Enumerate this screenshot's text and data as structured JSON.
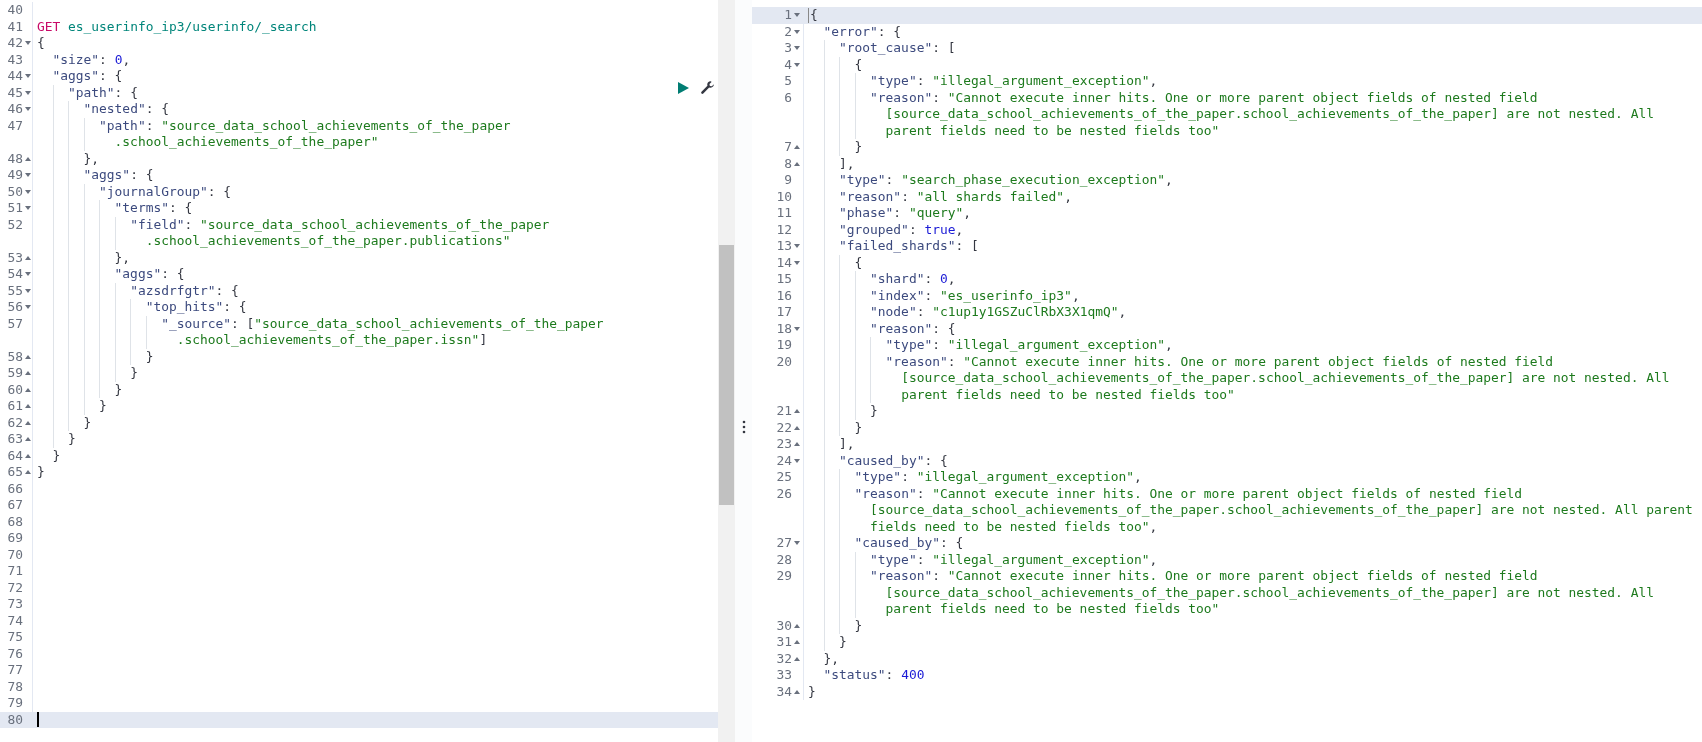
{
  "request_editor": {
    "lines": [
      {
        "number": "40",
        "fold_start": false,
        "fold_end": false,
        "active": false
      },
      {
        "number": "41",
        "fold_start": false,
        "fold_end": false,
        "active": false,
        "tokens": [
          {
            "kind": "method",
            "text": "GET"
          },
          {
            "kind": "url",
            "text": " es_userinfo_ip3/userinfo/_search"
          }
        ]
      },
      {
        "number": "42",
        "fold_start": true,
        "fold_end": false,
        "active": false,
        "tokens": [
          {
            "kind": "punct",
            "text": "{"
          }
        ]
      },
      {
        "number": "43",
        "fold_start": false,
        "fold_end": false,
        "active": false,
        "tokens": [
          {
            "kind": "key",
            "text": "  \"size\""
          },
          {
            "kind": "punct",
            "text": ": "
          },
          {
            "kind": "number",
            "text": "0"
          },
          {
            "kind": "punct",
            "text": ","
          }
        ]
      },
      {
        "number": "44",
        "fold_start": true,
        "fold_end": false,
        "active": false,
        "tokens": [
          {
            "kind": "key",
            "text": "  \"aggs\""
          },
          {
            "kind": "punct",
            "text": ": {"
          }
        ]
      },
      {
        "number": "45",
        "fold_start": true,
        "fold_end": false,
        "active": false,
        "tokens": [
          {
            "kind": "key",
            "text": "    \"path\""
          },
          {
            "kind": "punct",
            "text": ": {"
          }
        ]
      },
      {
        "number": "46",
        "fold_start": true,
        "fold_end": false,
        "active": false,
        "tokens": [
          {
            "kind": "key",
            "text": "      \"nested\""
          },
          {
            "kind": "punct",
            "text": ": {"
          }
        ]
      },
      {
        "number": "47",
        "fold_start": false,
        "fold_end": false,
        "active": false,
        "tokens": [
          {
            "kind": "key",
            "text": "        \"path\""
          },
          {
            "kind": "punct",
            "text": ": "
          },
          {
            "kind": "string",
            "text": "\"source_data_school_achievements_of_the_paper"
          }
        ]
      },
      {
        "fold_start": false,
        "fold_end": false,
        "active": false,
        "tokens": [
          {
            "kind": "string",
            "text": "          .school_achievements_of_the_paper\""
          }
        ]
      },
      {
        "number": "48",
        "fold_start": false,
        "fold_end": true,
        "active": false,
        "tokens": [
          {
            "kind": "punct",
            "text": "      },"
          }
        ]
      },
      {
        "number": "49",
        "fold_start": true,
        "fold_end": false,
        "active": false,
        "tokens": [
          {
            "kind": "key",
            "text": "      \"aggs\""
          },
          {
            "kind": "punct",
            "text": ": {"
          }
        ]
      },
      {
        "number": "50",
        "fold_start": true,
        "fold_end": false,
        "active": false,
        "tokens": [
          {
            "kind": "key",
            "text": "        \"journalGroup\""
          },
          {
            "kind": "punct",
            "text": ": {"
          }
        ]
      },
      {
        "number": "51",
        "fold_start": true,
        "fold_end": false,
        "active": false,
        "tokens": [
          {
            "kind": "key",
            "text": "          \"terms\""
          },
          {
            "kind": "punct",
            "text": ": {"
          }
        ]
      },
      {
        "number": "52",
        "fold_start": false,
        "fold_end": false,
        "active": false,
        "tokens": [
          {
            "kind": "key",
            "text": "            \"field\""
          },
          {
            "kind": "punct",
            "text": ": "
          },
          {
            "kind": "string",
            "text": "\"source_data_school_achievements_of_the_paper"
          }
        ]
      },
      {
        "fold_start": false,
        "fold_end": false,
        "active": false,
        "tokens": [
          {
            "kind": "string",
            "text": "              .school_achievements_of_the_paper.publications\""
          }
        ]
      },
      {
        "number": "53",
        "fold_start": false,
        "fold_end": true,
        "active": false,
        "tokens": [
          {
            "kind": "punct",
            "text": "          },"
          }
        ]
      },
      {
        "number": "54",
        "fold_start": true,
        "fold_end": false,
        "active": false,
        "tokens": [
          {
            "kind": "key",
            "text": "          \"aggs\""
          },
          {
            "kind": "punct",
            "text": ": {"
          }
        ]
      },
      {
        "number": "55",
        "fold_start": true,
        "fold_end": false,
        "active": false,
        "tokens": [
          {
            "kind": "key",
            "text": "            \"azsdrfgtr\""
          },
          {
            "kind": "punct",
            "text": ": {"
          }
        ]
      },
      {
        "number": "56",
        "fold_start": true,
        "fold_end": false,
        "active": false,
        "tokens": [
          {
            "kind": "key",
            "text": "              \"top_hits\""
          },
          {
            "kind": "punct",
            "text": ": {"
          }
        ]
      },
      {
        "number": "57",
        "fold_start": false,
        "fold_end": false,
        "active": false,
        "tokens": [
          {
            "kind": "key",
            "text": "                \"_source\""
          },
          {
            "kind": "punct",
            "text": ": ["
          },
          {
            "kind": "string",
            "text": "\"source_data_school_achievements_of_the_paper"
          }
        ]
      },
      {
        "fold_start": false,
        "fold_end": false,
        "active": false,
        "tokens": [
          {
            "kind": "string",
            "text": "                  .school_achievements_of_the_paper.issn\""
          },
          {
            "kind": "punct",
            "text": "]"
          }
        ]
      },
      {
        "number": "58",
        "fold_start": false,
        "fold_end": true,
        "active": false,
        "tokens": [
          {
            "kind": "punct",
            "text": "              }"
          }
        ]
      },
      {
        "number": "59",
        "fold_start": false,
        "fold_end": true,
        "active": false,
        "tokens": [
          {
            "kind": "punct",
            "text": "            }"
          }
        ]
      },
      {
        "number": "60",
        "fold_start": false,
        "fold_end": true,
        "active": false,
        "tokens": [
          {
            "kind": "punct",
            "text": "          }"
          }
        ]
      },
      {
        "number": "61",
        "fold_start": false,
        "fold_end": true,
        "active": false,
        "tokens": [
          {
            "kind": "punct",
            "text": "        }"
          }
        ]
      },
      {
        "number": "62",
        "fold_start": false,
        "fold_end": true,
        "active": false,
        "tokens": [
          {
            "kind": "punct",
            "text": "      }"
          }
        ]
      },
      {
        "number": "63",
        "fold_start": false,
        "fold_end": true,
        "active": false,
        "tokens": [
          {
            "kind": "punct",
            "text": "    }"
          }
        ]
      },
      {
        "number": "64",
        "fold_start": false,
        "fold_end": true,
        "active": false,
        "tokens": [
          {
            "kind": "punct",
            "text": "  }"
          }
        ]
      },
      {
        "number": "65",
        "fold_start": false,
        "fold_end": true,
        "active": false,
        "tokens": [
          {
            "kind": "punct",
            "text": "}"
          }
        ]
      },
      {
        "number": "66",
        "fold_start": false,
        "fold_end": false,
        "active": false
      },
      {
        "number": "67",
        "fold_start": false,
        "fold_end": false,
        "active": false
      },
      {
        "number": "68",
        "fold_start": false,
        "fold_end": false,
        "active": false
      },
      {
        "number": "69",
        "fold_start": false,
        "fold_end": false,
        "active": false
      },
      {
        "number": "70",
        "fold_start": false,
        "fold_end": false,
        "active": false
      },
      {
        "number": "71",
        "fold_start": false,
        "fold_end": false,
        "active": false
      },
      {
        "number": "72",
        "fold_start": false,
        "fold_end": false,
        "active": false
      },
      {
        "number": "73",
        "fold_start": false,
        "fold_end": false,
        "active": false
      },
      {
        "number": "74",
        "fold_start": false,
        "fold_end": false,
        "active": false
      },
      {
        "number": "75",
        "fold_start": false,
        "fold_end": false,
        "active": false
      },
      {
        "number": "76",
        "fold_start": false,
        "fold_end": false,
        "active": false
      },
      {
        "number": "77",
        "fold_start": false,
        "fold_end": false,
        "active": false
      },
      {
        "number": "78",
        "fold_start": false,
        "fold_end": false,
        "active": false
      },
      {
        "number": "79",
        "fold_start": false,
        "fold_end": false,
        "active": false
      },
      {
        "number": "80",
        "fold_start": false,
        "fold_end": false,
        "active": true
      }
    ]
  },
  "response_viewer": {
    "lines": [
      {
        "number": "1",
        "fold_start": true,
        "fold_end": false,
        "active": true,
        "tokens": [
          {
            "kind": "punct",
            "text": "{"
          }
        ]
      },
      {
        "number": "2",
        "fold_start": true,
        "fold_end": false,
        "active": false,
        "tokens": [
          {
            "kind": "key",
            "text": "  \"error\""
          },
          {
            "kind": "punct",
            "text": ": {"
          }
        ]
      },
      {
        "number": "3",
        "fold_start": true,
        "fold_end": false,
        "active": false,
        "tokens": [
          {
            "kind": "key",
            "text": "    \"root_cause\""
          },
          {
            "kind": "punct",
            "text": ": ["
          }
        ]
      },
      {
        "number": "4",
        "fold_start": true,
        "fold_end": false,
        "active": false,
        "tokens": [
          {
            "kind": "punct",
            "text": "      {"
          }
        ]
      },
      {
        "number": "5",
        "fold_start": false,
        "fold_end": false,
        "active": false,
        "tokens": [
          {
            "kind": "key",
            "text": "        \"type\""
          },
          {
            "kind": "punct",
            "text": ": "
          },
          {
            "kind": "string",
            "text": "\"illegal_argument_exception\""
          },
          {
            "kind": "punct",
            "text": ","
          }
        ]
      },
      {
        "number": "6",
        "fold_start": false,
        "fold_end": false,
        "active": false,
        "tokens": [
          {
            "kind": "key",
            "text": "        \"reason\""
          },
          {
            "kind": "punct",
            "text": ": "
          },
          {
            "kind": "string",
            "text": "\"Cannot execute inner hits. One or more parent object fields of nested field"
          }
        ]
      },
      {
        "fold_start": false,
        "fold_end": false,
        "active": false,
        "tokens": [
          {
            "kind": "string",
            "text": "          [source_data_school_achievements_of_the_paper.school_achievements_of_the_paper] are not nested. All"
          }
        ]
      },
      {
        "fold_start": false,
        "fold_end": false,
        "active": false,
        "tokens": [
          {
            "kind": "string",
            "text": "          parent fields need to be nested fields too\""
          }
        ]
      },
      {
        "number": "7",
        "fold_start": false,
        "fold_end": true,
        "active": false,
        "tokens": [
          {
            "kind": "punct",
            "text": "      }"
          }
        ]
      },
      {
        "number": "8",
        "fold_start": false,
        "fold_end": true,
        "active": false,
        "tokens": [
          {
            "kind": "punct",
            "text": "    ],"
          }
        ]
      },
      {
        "number": "9",
        "fold_start": false,
        "fold_end": false,
        "active": false,
        "tokens": [
          {
            "kind": "key",
            "text": "    \"type\""
          },
          {
            "kind": "punct",
            "text": ": "
          },
          {
            "kind": "string",
            "text": "\"search_phase_execution_exception\""
          },
          {
            "kind": "punct",
            "text": ","
          }
        ]
      },
      {
        "number": "10",
        "fold_start": false,
        "fold_end": false,
        "active": false,
        "tokens": [
          {
            "kind": "key",
            "text": "    \"reason\""
          },
          {
            "kind": "punct",
            "text": ": "
          },
          {
            "kind": "string",
            "text": "\"all shards failed\""
          },
          {
            "kind": "punct",
            "text": ","
          }
        ]
      },
      {
        "number": "11",
        "fold_start": false,
        "fold_end": false,
        "active": false,
        "tokens": [
          {
            "kind": "key",
            "text": "    \"phase\""
          },
          {
            "kind": "punct",
            "text": ": "
          },
          {
            "kind": "string",
            "text": "\"query\""
          },
          {
            "kind": "punct",
            "text": ","
          }
        ]
      },
      {
        "number": "12",
        "fold_start": false,
        "fold_end": false,
        "active": false,
        "tokens": [
          {
            "kind": "key",
            "text": "    \"grouped\""
          },
          {
            "kind": "punct",
            "text": ": "
          },
          {
            "kind": "bool",
            "text": "true"
          },
          {
            "kind": "punct",
            "text": ","
          }
        ]
      },
      {
        "number": "13",
        "fold_start": true,
        "fold_end": false,
        "active": false,
        "tokens": [
          {
            "kind": "key",
            "text": "    \"failed_shards\""
          },
          {
            "kind": "punct",
            "text": ": ["
          }
        ]
      },
      {
        "number": "14",
        "fold_start": true,
        "fold_end": false,
        "active": false,
        "tokens": [
          {
            "kind": "punct",
            "text": "      {"
          }
        ]
      },
      {
        "number": "15",
        "fold_start": false,
        "fold_end": false,
        "active": false,
        "tokens": [
          {
            "kind": "key",
            "text": "        \"shard\""
          },
          {
            "kind": "punct",
            "text": ": "
          },
          {
            "kind": "number",
            "text": "0"
          },
          {
            "kind": "punct",
            "text": ","
          }
        ]
      },
      {
        "number": "16",
        "fold_start": false,
        "fold_end": false,
        "active": false,
        "tokens": [
          {
            "kind": "key",
            "text": "        \"index\""
          },
          {
            "kind": "punct",
            "text": ": "
          },
          {
            "kind": "string",
            "text": "\"es_userinfo_ip3\""
          },
          {
            "kind": "punct",
            "text": ","
          }
        ]
      },
      {
        "number": "17",
        "fold_start": false,
        "fold_end": false,
        "active": false,
        "tokens": [
          {
            "kind": "key",
            "text": "        \"node\""
          },
          {
            "kind": "punct",
            "text": ": "
          },
          {
            "kind": "string",
            "text": "\"c1up1y1GSZuClRbX3X1qmQ\""
          },
          {
            "kind": "punct",
            "text": ","
          }
        ]
      },
      {
        "number": "18",
        "fold_start": true,
        "fold_end": false,
        "active": false,
        "tokens": [
          {
            "kind": "key",
            "text": "        \"reason\""
          },
          {
            "kind": "punct",
            "text": ": {"
          }
        ]
      },
      {
        "number": "19",
        "fold_start": false,
        "fold_end": false,
        "active": false,
        "tokens": [
          {
            "kind": "key",
            "text": "          \"type\""
          },
          {
            "kind": "punct",
            "text": ": "
          },
          {
            "kind": "string",
            "text": "\"illegal_argument_exception\""
          },
          {
            "kind": "punct",
            "text": ","
          }
        ]
      },
      {
        "number": "20",
        "fold_start": false,
        "fold_end": false,
        "active": false,
        "tokens": [
          {
            "kind": "key",
            "text": "          \"reason\""
          },
          {
            "kind": "punct",
            "text": ": "
          },
          {
            "kind": "string",
            "text": "\"Cannot execute inner hits. One or more parent object fields of nested field"
          }
        ]
      },
      {
        "fold_start": false,
        "fold_end": false,
        "active": false,
        "tokens": [
          {
            "kind": "string",
            "text": "            [source_data_school_achievements_of_the_paper.school_achievements_of_the_paper] are not nested. All"
          }
        ]
      },
      {
        "fold_start": false,
        "fold_end": false,
        "active": false,
        "tokens": [
          {
            "kind": "string",
            "text": "            parent fields need to be nested fields too\""
          }
        ]
      },
      {
        "number": "21",
        "fold_start": false,
        "fold_end": true,
        "active": false,
        "tokens": [
          {
            "kind": "punct",
            "text": "        }"
          }
        ]
      },
      {
        "number": "22",
        "fold_start": false,
        "fold_end": true,
        "active": false,
        "tokens": [
          {
            "kind": "punct",
            "text": "      }"
          }
        ]
      },
      {
        "number": "23",
        "fold_start": false,
        "fold_end": true,
        "active": false,
        "tokens": [
          {
            "kind": "punct",
            "text": "    ],"
          }
        ]
      },
      {
        "number": "24",
        "fold_start": true,
        "fold_end": false,
        "active": false,
        "tokens": [
          {
            "kind": "key",
            "text": "    \"caused_by\""
          },
          {
            "kind": "punct",
            "text": ": {"
          }
        ]
      },
      {
        "number": "25",
        "fold_start": false,
        "fold_end": false,
        "active": false,
        "tokens": [
          {
            "kind": "key",
            "text": "      \"type\""
          },
          {
            "kind": "punct",
            "text": ": "
          },
          {
            "kind": "string",
            "text": "\"illegal_argument_exception\""
          },
          {
            "kind": "punct",
            "text": ","
          }
        ]
      },
      {
        "number": "26",
        "fold_start": false,
        "fold_end": false,
        "active": false,
        "tokens": [
          {
            "kind": "key",
            "text": "      \"reason\""
          },
          {
            "kind": "punct",
            "text": ": "
          },
          {
            "kind": "string",
            "text": "\"Cannot execute inner hits. One or more parent object fields of nested field"
          }
        ]
      },
      {
        "fold_start": false,
        "fold_end": false,
        "active": false,
        "tokens": [
          {
            "kind": "string",
            "text": "        [source_data_school_achievements_of_the_paper.school_achievements_of_the_paper] are not nested. All parent"
          }
        ]
      },
      {
        "fold_start": false,
        "fold_end": false,
        "active": false,
        "tokens": [
          {
            "kind": "string",
            "text": "        fields need to be nested fields too\""
          },
          {
            "kind": "punct",
            "text": ","
          }
        ]
      },
      {
        "number": "27",
        "fold_start": true,
        "fold_end": false,
        "active": false,
        "tokens": [
          {
            "kind": "key",
            "text": "      \"caused_by\""
          },
          {
            "kind": "punct",
            "text": ": {"
          }
        ]
      },
      {
        "number": "28",
        "fold_start": false,
        "fold_end": false,
        "active": false,
        "tokens": [
          {
            "kind": "key",
            "text": "        \"type\""
          },
          {
            "kind": "punct",
            "text": ": "
          },
          {
            "kind": "string",
            "text": "\"illegal_argument_exception\""
          },
          {
            "kind": "punct",
            "text": ","
          }
        ]
      },
      {
        "number": "29",
        "fold_start": false,
        "fold_end": false,
        "active": false,
        "tokens": [
          {
            "kind": "key",
            "text": "        \"reason\""
          },
          {
            "kind": "punct",
            "text": ": "
          },
          {
            "kind": "string",
            "text": "\"Cannot execute inner hits. One or more parent object fields of nested field"
          }
        ]
      },
      {
        "fold_start": false,
        "fold_end": false,
        "active": false,
        "tokens": [
          {
            "kind": "string",
            "text": "          [source_data_school_achievements_of_the_paper.school_achievements_of_the_paper] are not nested. All"
          }
        ]
      },
      {
        "fold_start": false,
        "fold_end": false,
        "active": false,
        "tokens": [
          {
            "kind": "string",
            "text": "          parent fields need to be nested fields too\""
          }
        ]
      },
      {
        "number": "30",
        "fold_start": false,
        "fold_end": true,
        "active": false,
        "tokens": [
          {
            "kind": "punct",
            "text": "      }"
          }
        ]
      },
      {
        "number": "31",
        "fold_start": false,
        "fold_end": true,
        "active": false,
        "tokens": [
          {
            "kind": "punct",
            "text": "    }"
          }
        ]
      },
      {
        "number": "32",
        "fold_start": false,
        "fold_end": true,
        "active": false,
        "tokens": [
          {
            "kind": "punct",
            "text": "  },"
          }
        ]
      },
      {
        "number": "33",
        "fold_start": false,
        "fold_end": false,
        "active": false,
        "tokens": [
          {
            "kind": "key",
            "text": "  \"status\""
          },
          {
            "kind": "punct",
            "text": ": "
          },
          {
            "kind": "number",
            "text": "400"
          }
        ]
      },
      {
        "number": "34",
        "fold_start": false,
        "fold_end": true,
        "active": false,
        "tokens": [
          {
            "kind": "punct",
            "text": "}"
          }
        ]
      }
    ]
  }
}
